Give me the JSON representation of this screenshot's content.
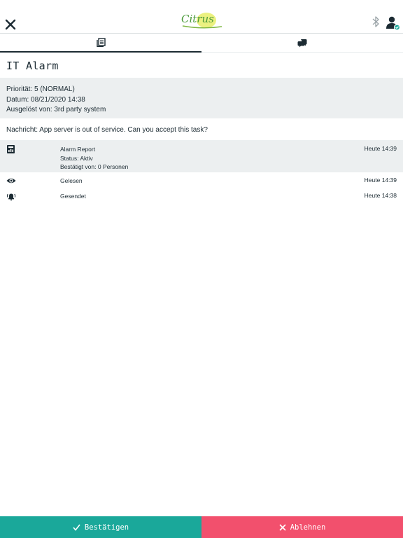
{
  "header": {
    "logo_text": "Citrus",
    "close_icon": "close-icon",
    "bluetooth_icon": "bluetooth-icon",
    "user_icon": "user-status-icon"
  },
  "tabs": [
    {
      "icon": "document-list-icon",
      "active": true
    },
    {
      "icon": "chat-bubbles-icon",
      "active": false
    }
  ],
  "alarm": {
    "title": "IT Alarm",
    "priority": "Priorität: 5 (NORMAL)",
    "date": "Datum: 08/21/2020 14:38",
    "triggered_by": "Ausgelöst von: 3rd party system",
    "message": "Nachricht: App server is out of service. Can you accept this task?"
  },
  "log": [
    {
      "icon": "report-icon",
      "lines": [
        "Alarm Report",
        "Status: Aktiv",
        "Bestätigt von: 0 Personen"
      ],
      "time": "Heute 14:39"
    },
    {
      "icon": "eye-icon",
      "lines": [
        "Gelesen"
      ],
      "time": "Heute 14:39"
    },
    {
      "icon": "alarm-bell-icon",
      "lines": [
        "Gesendet"
      ],
      "time": "Heute 14:38"
    }
  ],
  "actions": {
    "confirm_label": "Bestätigen",
    "reject_label": "Ablehnen"
  },
  "colors": {
    "confirm": "#1aa89a",
    "reject": "#f2506d",
    "text": "#1c2b33",
    "panel": "#eceff0"
  }
}
